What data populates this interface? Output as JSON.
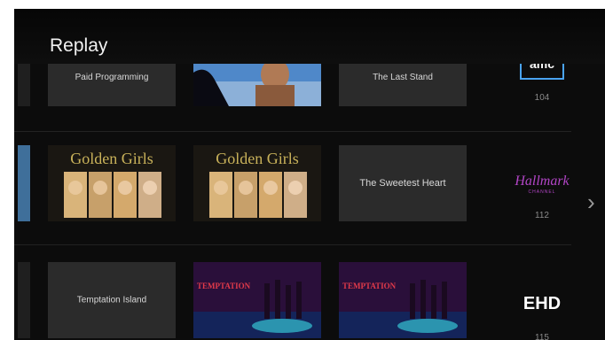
{
  "header": {
    "title": "Replay"
  },
  "rows": [
    {
      "tiles": [
        "Paid Programming",
        "",
        "The Last Stand"
      ],
      "channel": {
        "logo": "amc",
        "number": "104"
      }
    },
    {
      "tiles": [
        "Golden Girls",
        "Golden Girls",
        "The Sweetest Heart"
      ],
      "channel": {
        "logo": "Hallmark",
        "logo_sub": "CHANNEL",
        "number": "112"
      }
    },
    {
      "tiles": [
        "Temptation Island",
        "TEMPTATION",
        "TEMPTATION"
      ],
      "channel": {
        "logo": "EHD",
        "number": "115"
      }
    }
  ],
  "icons": {
    "next": "chevron-right-icon"
  },
  "colors": {
    "background": "#0c0c0c",
    "tile": "#2b2b2b",
    "hallmark": "#b245c6",
    "amc_border": "#4aa3f0"
  }
}
